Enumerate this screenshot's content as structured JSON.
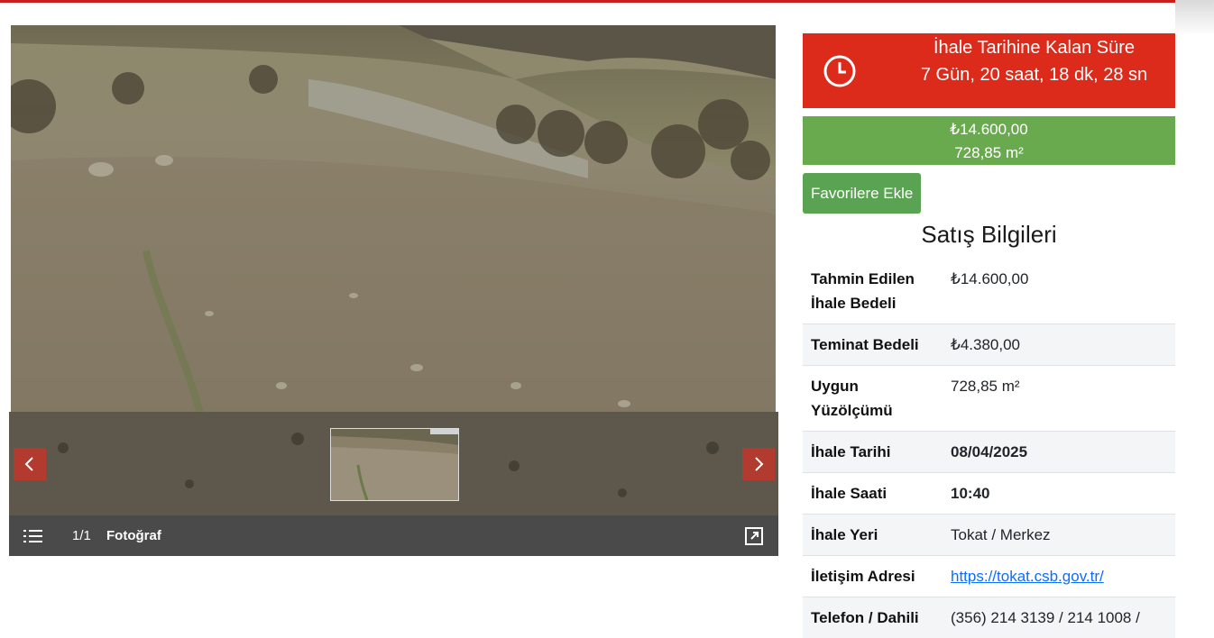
{
  "gallery": {
    "counter": "1/1",
    "photo_label": "Fotoğraf"
  },
  "timer": {
    "label": "İhale Tarihine Kalan Süre",
    "value": "7 Gün, 20 saat, 18 dk, 28 sn"
  },
  "price": {
    "amount": "₺14.600,00",
    "area": "728,85 m²"
  },
  "favorite_button": "Favorilere Ekle",
  "section_title": "Satış Bilgileri",
  "rows": [
    {
      "key": "Tahmin Edilen İhale Bedeli",
      "value": "₺14.600,00"
    },
    {
      "key": "Teminat Bedeli",
      "value": "₺4.380,00"
    },
    {
      "key": "Uygun Yüzölçümü",
      "value": "728,85 m²"
    },
    {
      "key": "İhale Tarihi",
      "value": "08/04/2025"
    },
    {
      "key": "İhale Saati",
      "value": "10:40"
    },
    {
      "key": "İhale Yeri",
      "value": "Tokat / Merkez"
    },
    {
      "key": "İletişim Adresi",
      "value": "https://tokat.csb.gov.tr/"
    },
    {
      "key": "Telefon / Dahili",
      "value": "(356) 214 3139 / 214 1008 /"
    }
  ],
  "colors": {
    "timer_bg": "#dc2a1b",
    "price_bg": "#6aaa4f",
    "favorite_bg": "#5aa352",
    "accent_line": "#c81e1e",
    "link": "#0d6efd"
  },
  "icons": [
    "clock-icon",
    "chevron-left-icon",
    "chevron-right-icon",
    "list-icon",
    "expand-icon"
  ]
}
